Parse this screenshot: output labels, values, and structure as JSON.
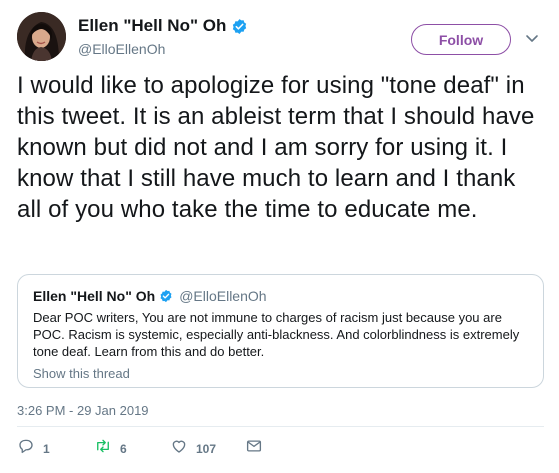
{
  "author": {
    "display_name": "Ellen \"Hell No\" Oh",
    "handle": "@ElloEllenOh"
  },
  "follow_button": {
    "label": "Follow"
  },
  "tweet": {
    "text": "I would like to apologize for using \"tone deaf\" in this tweet. It is an ableist term that I should have known but did not and I am sorry for using it. I know that I still have much to learn and I thank all of you who take the time to educate me."
  },
  "quoted_tweet": {
    "display_name": "Ellen \"Hell No\" Oh",
    "handle": "@ElloEllenOh",
    "text": "Dear POC writers, You are not immune to charges of racism just because you are POC. Racism is systemic, especially anti-blackness. And colorblindness is extremely tone deaf. Learn from this and do better.",
    "show_thread": "Show this thread"
  },
  "timestamp": "3:26 PM - 29 Jan 2019",
  "actions": {
    "replies": "1",
    "retweets": "6",
    "likes": "107"
  },
  "colors": {
    "accent": "#8d4fa6",
    "verified": "#1da1f2",
    "muted": "#657786",
    "retweet_icon": "#17bf63"
  },
  "icons": [
    "verified-badge-icon",
    "chevron-down-icon",
    "reply-icon",
    "retweet-icon",
    "like-icon",
    "message-icon"
  ]
}
